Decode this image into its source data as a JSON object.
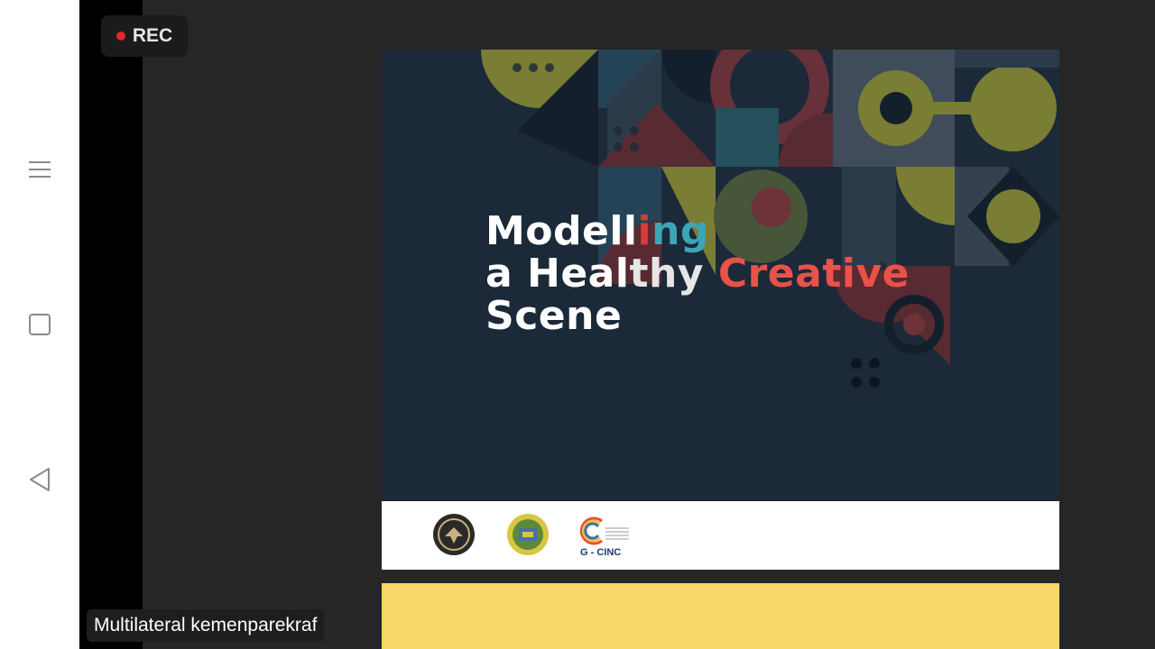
{
  "recording": {
    "label": "REC",
    "dot_color": "#e32626"
  },
  "nav": {
    "menu_icon": "menu-icon",
    "home_icon": "square-home-icon",
    "back_icon": "triangle-back-icon"
  },
  "slide": {
    "title_lines": [
      {
        "segments": [
          "Modell",
          "i",
          "ng"
        ]
      },
      {
        "segments": [
          "a Heal",
          "thy ",
          "Creative"
        ]
      },
      {
        "segments": [
          "Scene"
        ]
      }
    ],
    "background_color": "#1b2939",
    "logos": [
      {
        "icon": "government-seal-logo"
      },
      {
        "icon": "institution-crest-logo"
      },
      {
        "icon": "g-cinc-logo",
        "text": "G - CINC"
      }
    ],
    "panel_color": "#f5d869"
  },
  "caption": {
    "text": "Multilateral kemenparekraf"
  }
}
